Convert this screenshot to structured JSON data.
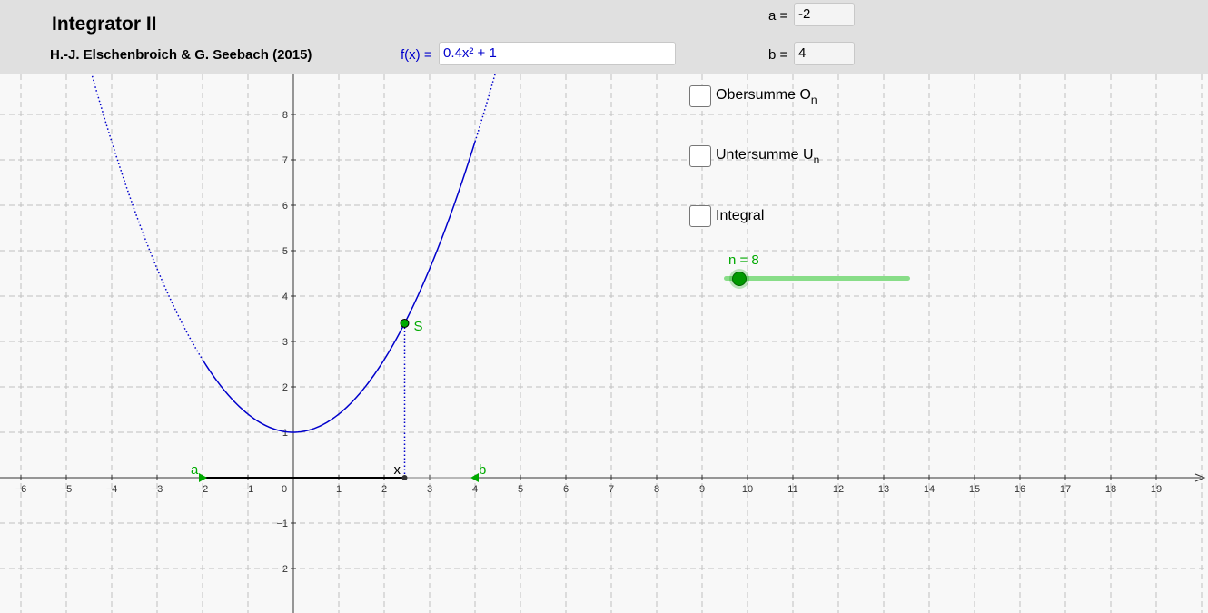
{
  "header": {
    "title": "Integrator II",
    "authors": "H.-J. Elschenbroich & G. Seebach (2015)"
  },
  "function_input": {
    "label": "f(x) =",
    "value": "0.4x² + 1"
  },
  "param_a": {
    "label": "a =",
    "value": "-2"
  },
  "param_b": {
    "label": "b =",
    "value": "4"
  },
  "checkboxes": [
    {
      "label": "Obersumme O",
      "subscript": "n",
      "checked": false
    },
    {
      "label": "Untersumme U",
      "subscript": "n",
      "checked": false
    },
    {
      "label": "Integral",
      "subscript": "",
      "checked": false
    }
  ],
  "slider": {
    "label": "n = 8",
    "value": 8,
    "fraction": 0.08
  },
  "graph": {
    "x_ticks": [
      "−6",
      "−5",
      "−4",
      "−3",
      "−2",
      "−1",
      "0",
      "1",
      "2",
      "3",
      "4",
      "5",
      "6",
      "7",
      "8",
      "9",
      "10",
      "11",
      "12",
      "13",
      "14",
      "15",
      "16",
      "17",
      "18",
      "19"
    ],
    "y_ticks": [
      "8",
      "7",
      "6",
      "5",
      "4",
      "3",
      "2",
      "1",
      "−1",
      "−2"
    ],
    "point_S_label": "S",
    "point_x_label": "x",
    "point_a_label": "a",
    "point_b_label": "b",
    "point_x_value": 2.45,
    "interval_a": -2,
    "interval_b": 4,
    "colors": {
      "curve": "#0000cc",
      "points": "#00aa00",
      "grid": "#c0c0c0"
    }
  }
}
